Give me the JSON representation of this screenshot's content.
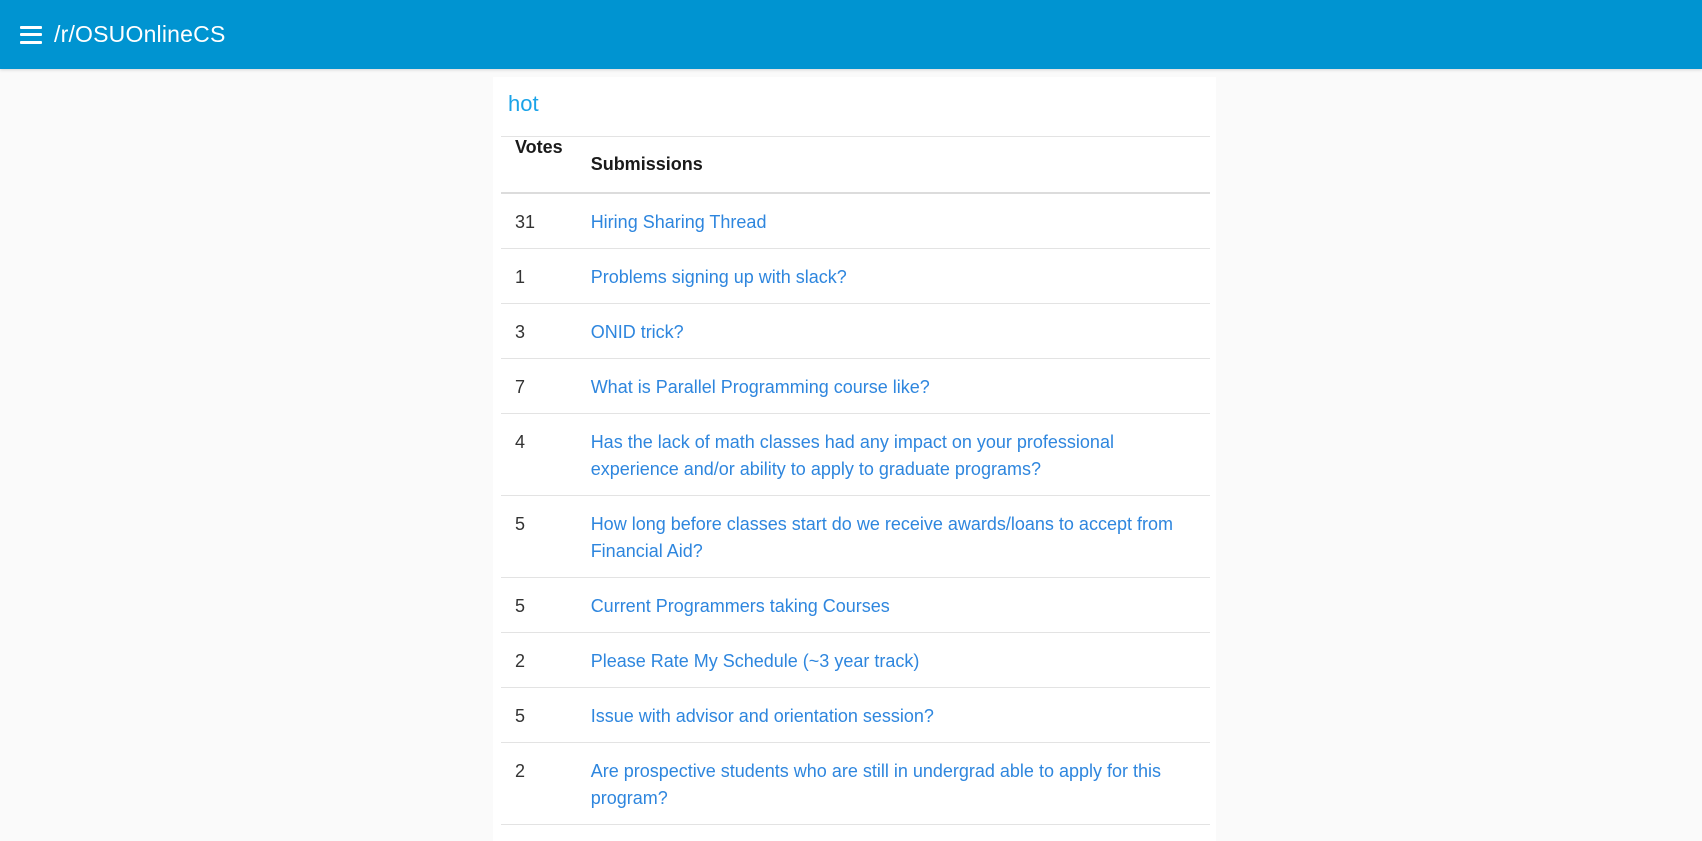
{
  "header": {
    "title": "/r/OSUOnlineCS",
    "menu_icon": "hamburger-menu-icon",
    "background": "#0094d1"
  },
  "feed": {
    "heading": "hot",
    "heading_color": "#1aa3e8",
    "columns": {
      "votes": "Votes",
      "submissions": "Submissions"
    },
    "link_color": "#2e86de",
    "rows": [
      {
        "votes": "31",
        "title": "Hiring Sharing Thread"
      },
      {
        "votes": "1",
        "title": "Problems signing up with slack?"
      },
      {
        "votes": "3",
        "title": "ONID trick?"
      },
      {
        "votes": "7",
        "title": "What is Parallel Programming course like?"
      },
      {
        "votes": "4",
        "title": "Has the lack of math classes had any impact on your professional experience and/or ability to apply to graduate programs?"
      },
      {
        "votes": "5",
        "title": "How long before classes start do we receive awards/loans to accept from Financial Aid?"
      },
      {
        "votes": "5",
        "title": "Current Programmers taking Courses"
      },
      {
        "votes": "2",
        "title": "Please Rate My Schedule (~3 year track)"
      },
      {
        "votes": "5",
        "title": "Issue with advisor and orientation session?"
      },
      {
        "votes": "2",
        "title": "Are prospective students who are still in undergrad able to apply for this program?"
      }
    ]
  }
}
